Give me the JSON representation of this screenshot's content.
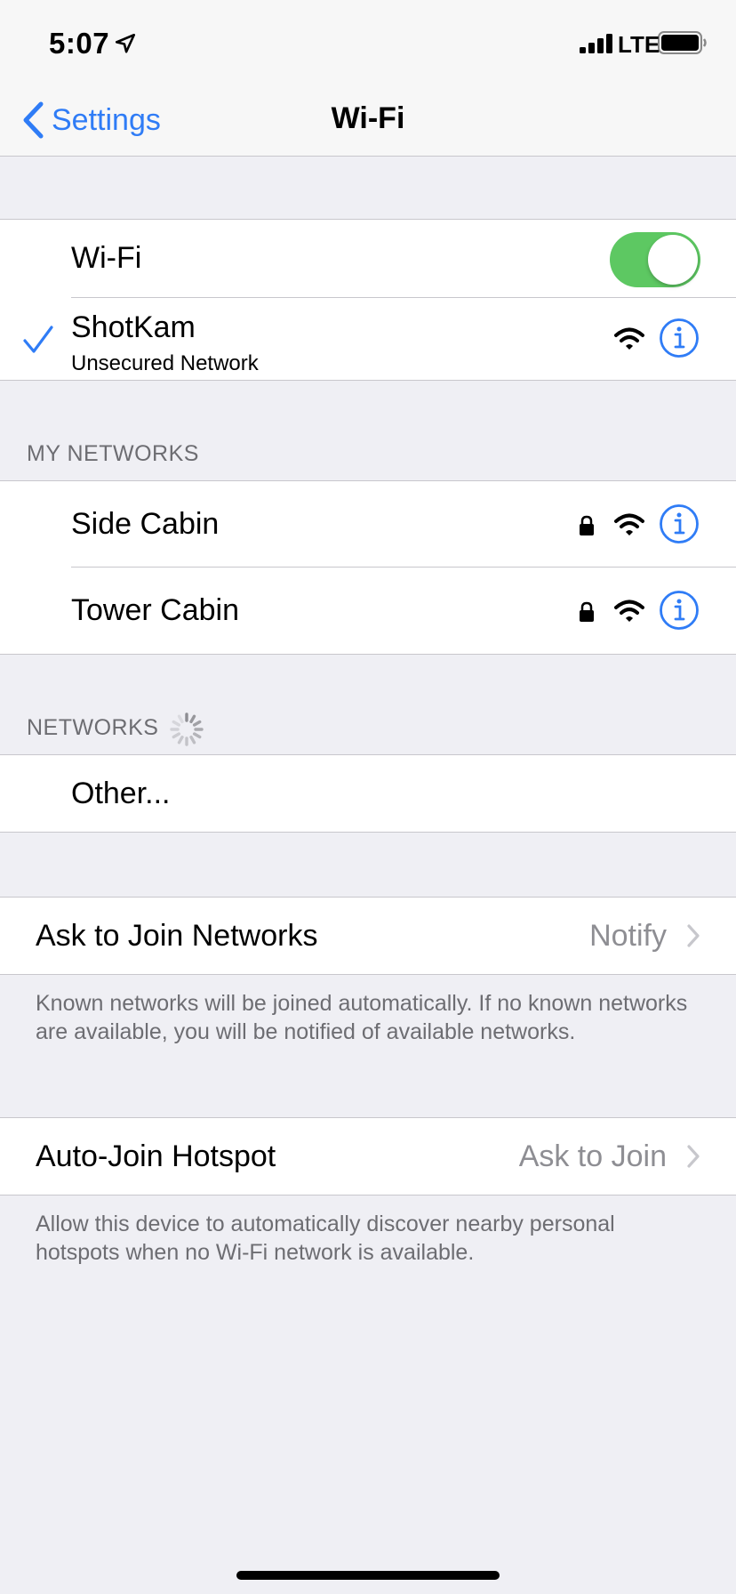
{
  "status_bar": {
    "time": "5:07",
    "carrier": "LTE"
  },
  "nav": {
    "back_label": "Settings",
    "title": "Wi-Fi"
  },
  "wifi_toggle": {
    "label": "Wi-Fi",
    "on": true
  },
  "current_network": {
    "name": "ShotKam",
    "subtitle": "Unsecured Network"
  },
  "my_networks": {
    "header": "MY NETWORKS",
    "items": [
      {
        "name": "Side Cabin",
        "locked": true
      },
      {
        "name": "Tower Cabin",
        "locked": true
      }
    ]
  },
  "networks": {
    "header": "NETWORKS",
    "other_label": "Other..."
  },
  "ask_to_join": {
    "label": "Ask to Join Networks",
    "value": "Notify",
    "footnote": "Known networks will be joined automatically. If no known networks are available, you will be notified of available networks."
  },
  "auto_join_hotspot": {
    "label": "Auto-Join Hotspot",
    "value": "Ask to Join",
    "footnote": "Allow this device to automatically discover nearby personal hotspots when no Wi-Fi network is available."
  },
  "colors": {
    "accent": "#2f7cf6",
    "toggle_on": "#5dc862",
    "background": "#efeff4",
    "secondary_text": "#8e8e93"
  },
  "icons": [
    "location-arrow-icon",
    "cellular-signal-icon",
    "battery-icon",
    "back-chevron-icon",
    "checkmark-icon",
    "wifi-icon",
    "lock-icon",
    "info-icon",
    "loading-spinner-icon",
    "chevron-right-icon"
  ]
}
